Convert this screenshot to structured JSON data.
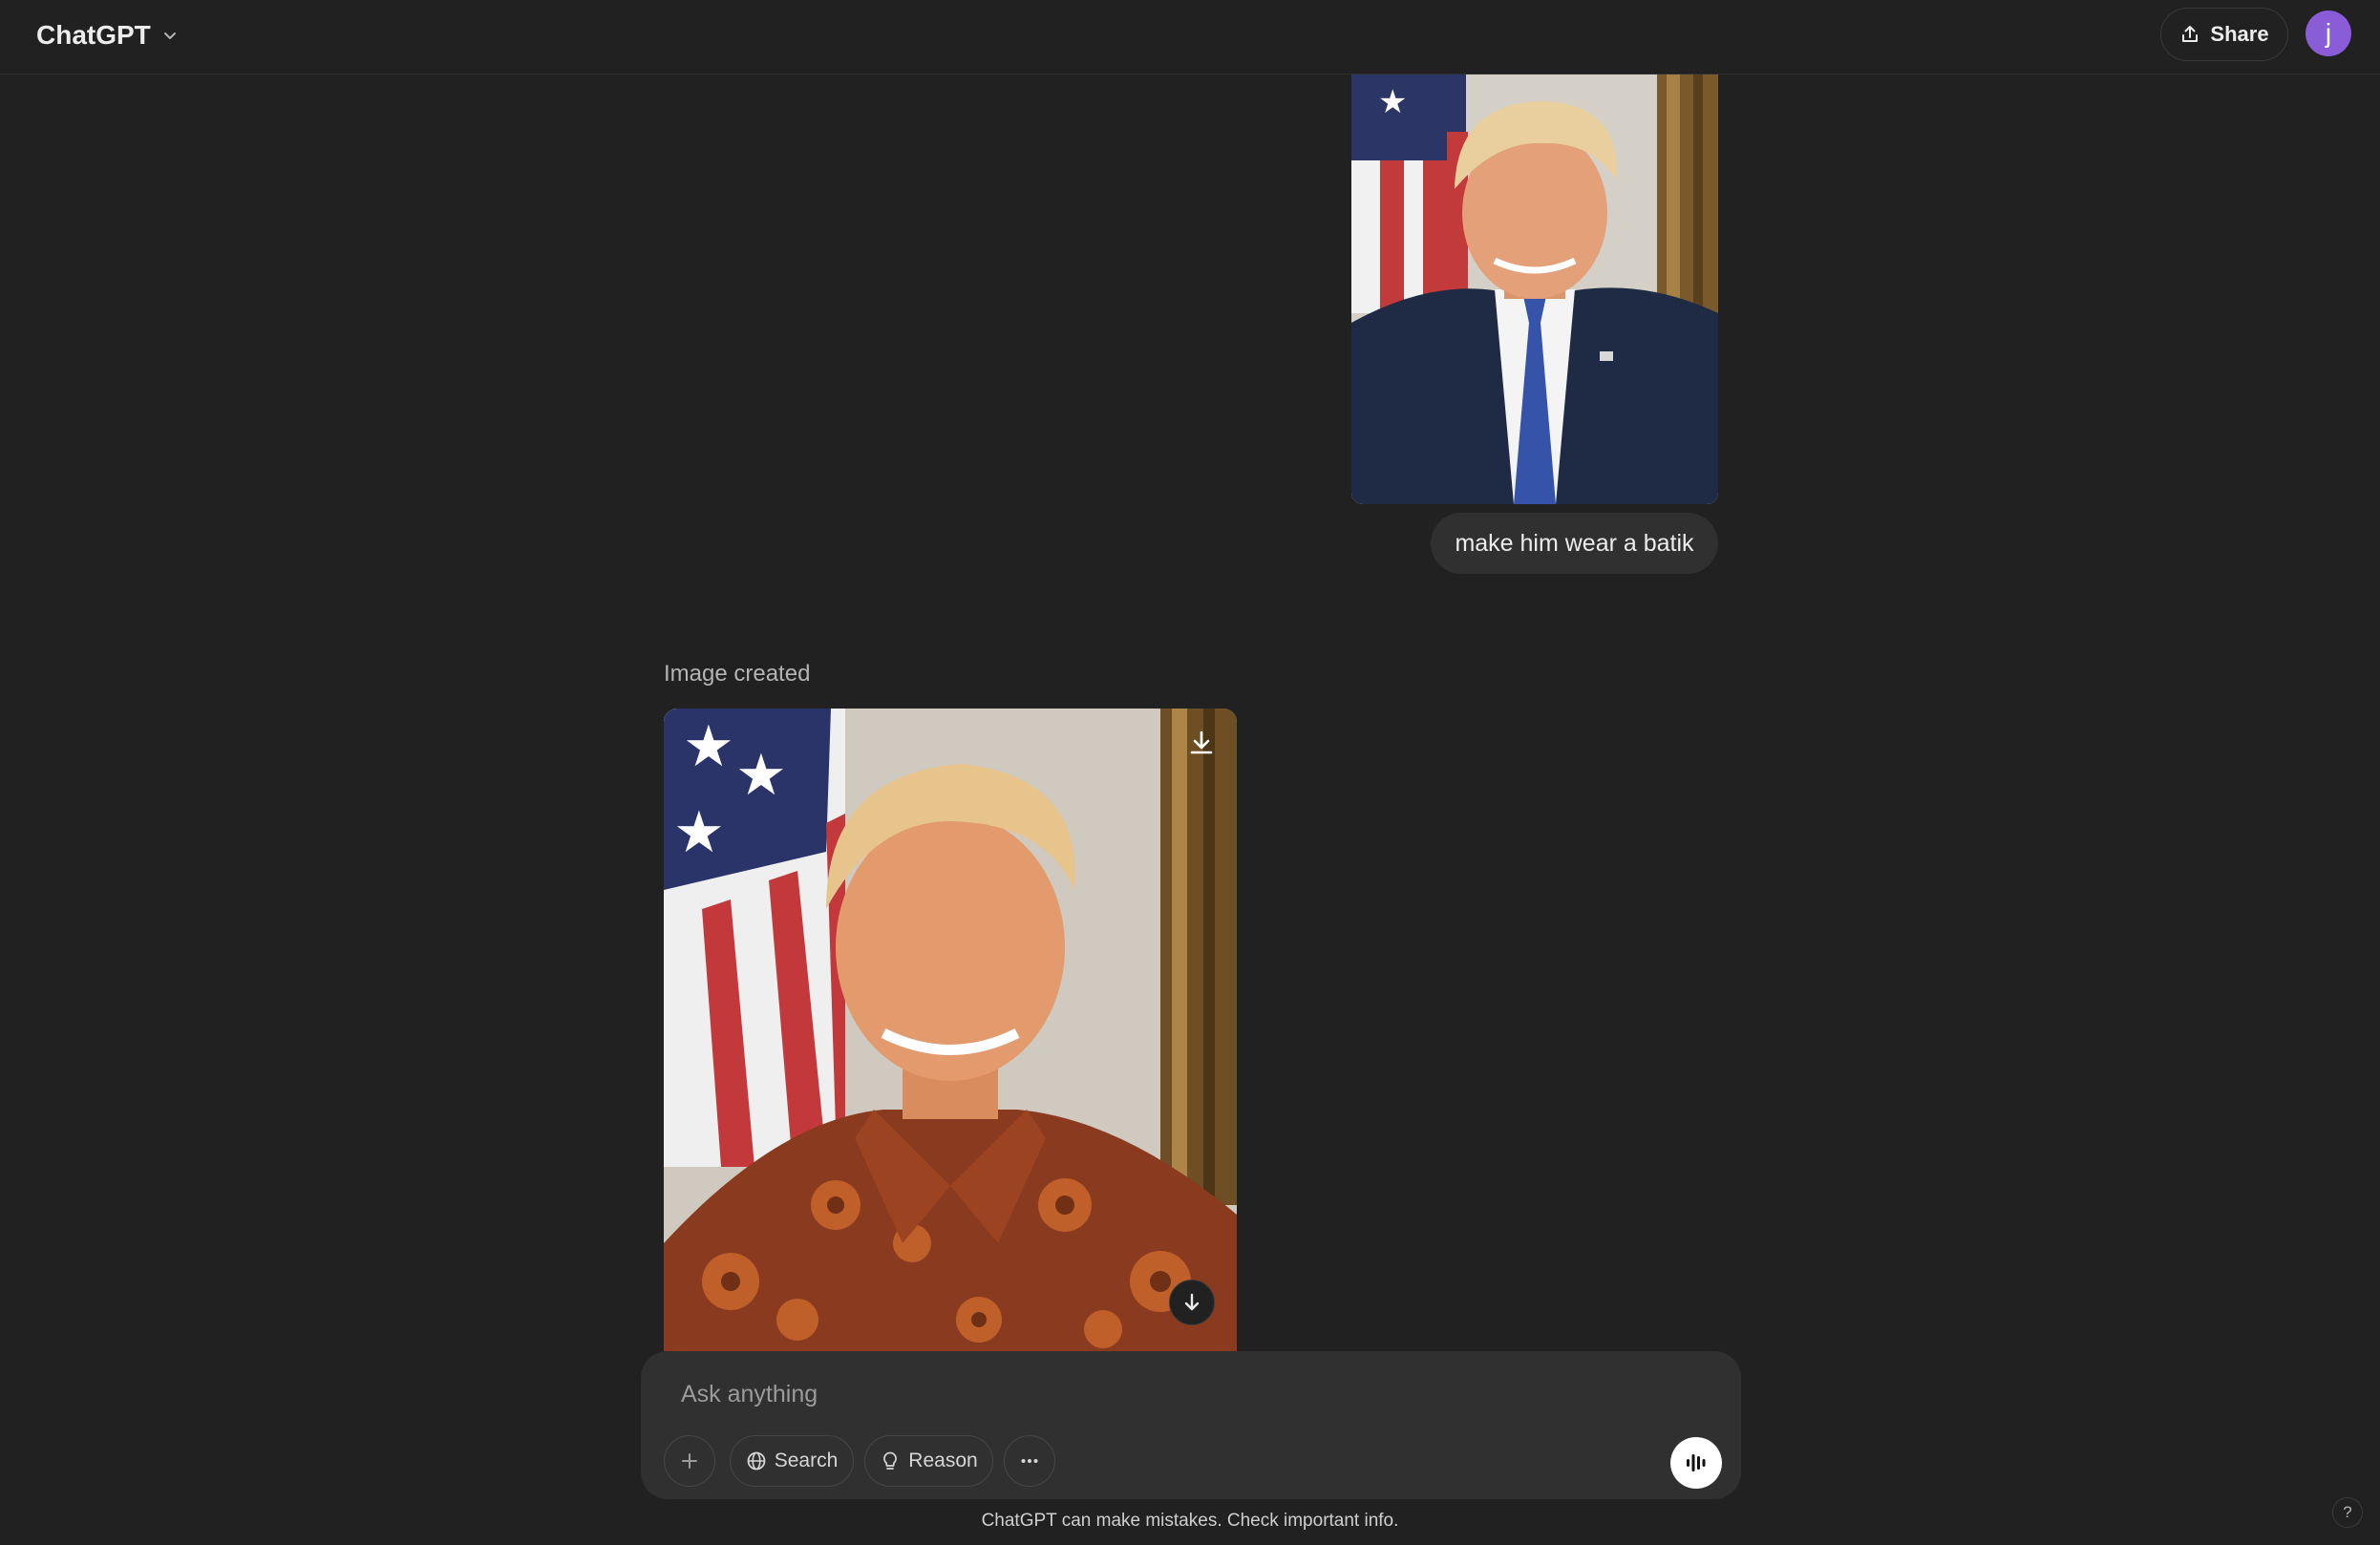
{
  "header": {
    "model_name": "ChatGPT",
    "share_label": "Share",
    "avatar_initial": "j"
  },
  "conversation": {
    "user_message": "make him wear a batik",
    "assistant_status": "Image created"
  },
  "composer": {
    "placeholder": "Ask anything",
    "search_label": "Search",
    "reason_label": "Reason"
  },
  "footer": {
    "disclaimer": "ChatGPT can make mistakes. Check important info.",
    "help_label": "?"
  },
  "colors": {
    "background": "#212121",
    "bubble": "#303030",
    "avatar": "#8a5cd8"
  }
}
